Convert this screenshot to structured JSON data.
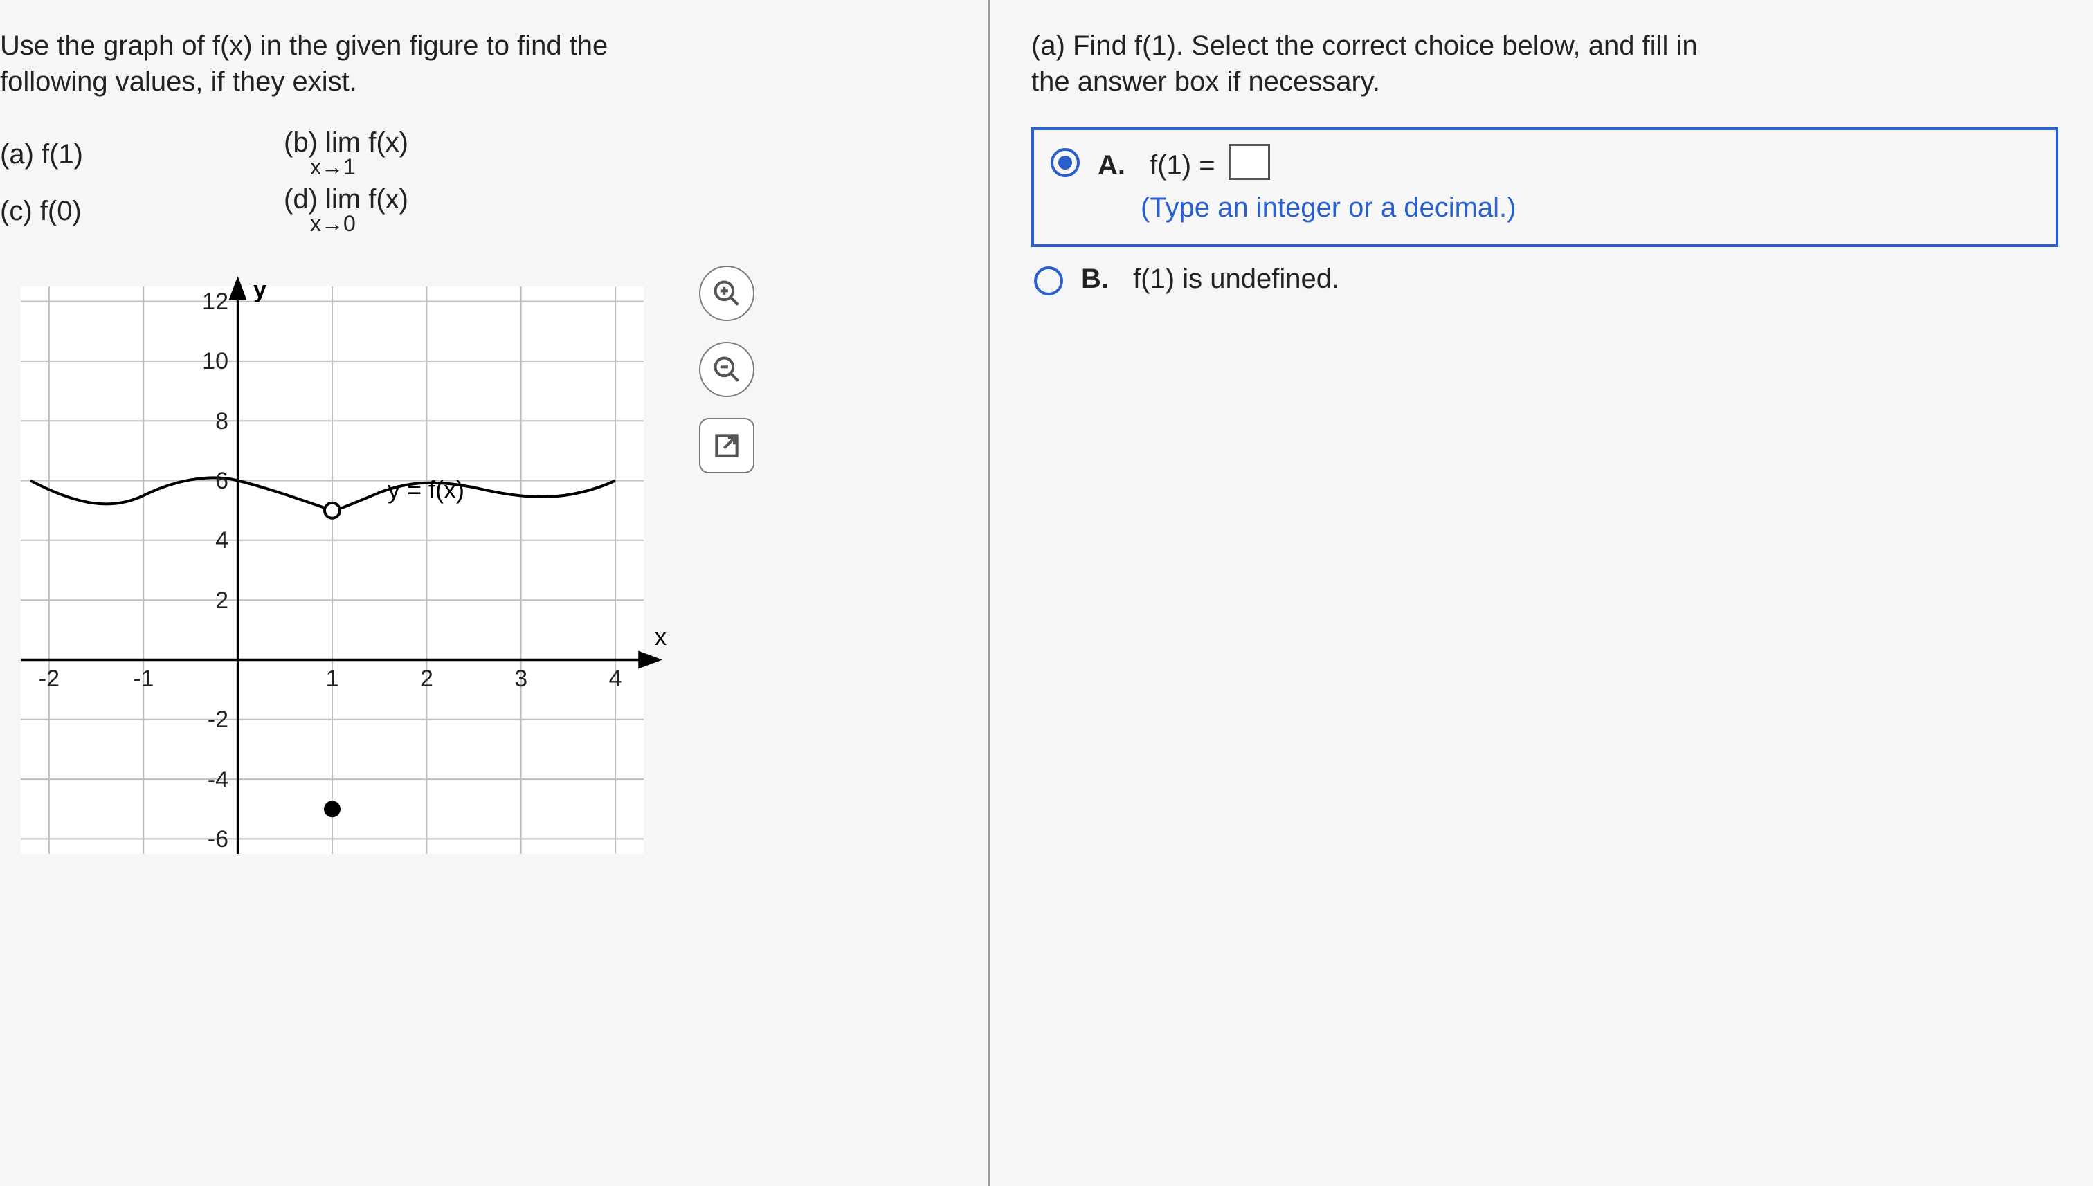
{
  "left": {
    "prompt_line1": "Use the graph of f(x) in the given figure to find the",
    "prompt_line2": "following values, if they exist.",
    "parts": {
      "a": "(a) f(1)",
      "b_top": "(b)  lim f(x)",
      "b_sub": "x→1",
      "c": "(c) f(0)",
      "d_top": "(d)  lim f(x)",
      "d_sub": "x→0"
    },
    "graph_caption": "y = f(x)",
    "axes": {
      "y_label": "y",
      "x_label": "x"
    },
    "tools": [
      "zoom-in",
      "zoom-out",
      "popout"
    ]
  },
  "right": {
    "question_line1": "(a) Find f(1). Select the correct choice below, and fill in",
    "question_line2": "the answer box if necessary.",
    "choiceA": {
      "letter": "A.",
      "text_prefix": "f(1) =",
      "hint": "(Type an integer or a decimal.)"
    },
    "choiceB": {
      "letter": "B.",
      "text": "f(1) is undefined."
    }
  },
  "chart_data": {
    "type": "line",
    "title": "",
    "xlabel": "x",
    "ylabel": "y",
    "xlim": [
      -2,
      4
    ],
    "ylim": [
      -6,
      12
    ],
    "x_ticks": [
      -2,
      -1,
      1,
      2,
      3,
      4
    ],
    "y_ticks": [
      -6,
      -4,
      -2,
      2,
      4,
      6,
      8,
      10,
      12
    ],
    "series": [
      {
        "name": "y = f(x)",
        "x": [
          -2.2,
          -1.5,
          -1.0,
          -0.5,
          0.0,
          0.5,
          1.0,
          1.5,
          2.0,
          2.6,
          3.2,
          4.0
        ],
        "values": [
          6.0,
          5.2,
          5.5,
          6.2,
          6.0,
          5.5,
          5.0,
          5.6,
          6.0,
          5.7,
          5.4,
          6.0
        ]
      }
    ],
    "points": [
      {
        "x": 1,
        "y": 5,
        "style": "open",
        "note": "hole on curve at x=1"
      },
      {
        "x": 1,
        "y": -5,
        "style": "closed",
        "note": "f(1) defined separately"
      }
    ]
  }
}
